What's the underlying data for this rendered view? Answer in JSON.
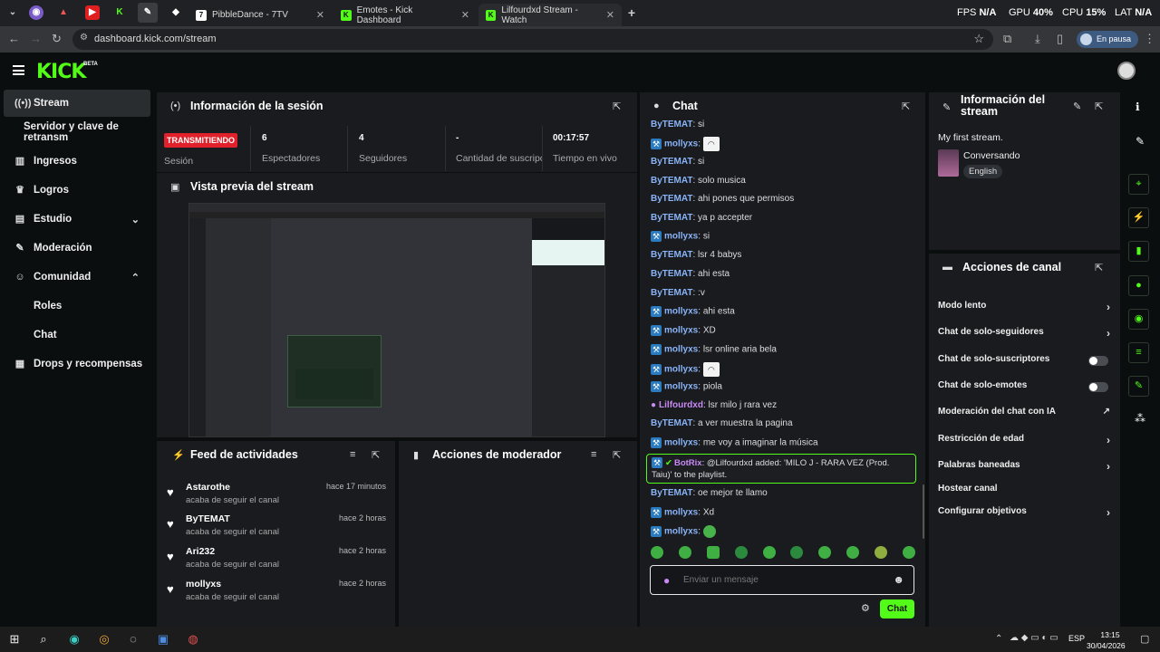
{
  "browser": {
    "tabs": [
      {
        "title": "PibbleDance - 7TV"
      },
      {
        "title": "Emotes - Kick Dashboard"
      },
      {
        "title": "Lilfourdxd Stream - Watch"
      }
    ],
    "stats": {
      "fps_label": "FPS",
      "fps": "N/A",
      "gpu_label": "GPU",
      "gpu": "40%",
      "cpu_label": "CPU",
      "cpu": "15%",
      "lat_label": "LAT",
      "lat": "N/A"
    },
    "url": "dashboard.kick.com/stream",
    "paused_label": "En pausa"
  },
  "kick": {
    "logo": "KICK",
    "beta": "BETA"
  },
  "sidebar": {
    "items": [
      {
        "label": "Stream",
        "icon": "broadcast-icon"
      },
      {
        "label": "Servidor y clave de retransm"
      },
      {
        "label": "Ingresos",
        "icon": "chart-icon"
      },
      {
        "label": "Logros",
        "icon": "trophy-icon"
      },
      {
        "label": "Estudio",
        "icon": "studio-icon"
      },
      {
        "label": "Moderación",
        "icon": "wrench-icon"
      },
      {
        "label": "Comunidad",
        "icon": "people-icon"
      },
      {
        "label": "Roles"
      },
      {
        "label": "Chat"
      },
      {
        "label": "Drops y recompensas",
        "icon": "gift-icon"
      }
    ]
  },
  "session": {
    "title": "Información de la sesión",
    "live_badge": "TRANSMITIENDO",
    "session_label": "Sesión",
    "stats": [
      {
        "value": "6",
        "label": "Espectadores"
      },
      {
        "value": "4",
        "label": "Seguidores"
      },
      {
        "value": "-",
        "label": "Cantidad de suscripciones"
      },
      {
        "value": "00:17:57",
        "label": "Tiempo en vivo"
      }
    ]
  },
  "preview": {
    "title": "Vista previa del stream"
  },
  "feed": {
    "title": "Feed de actividades",
    "items": [
      {
        "name": "Astarothe",
        "sub": "acaba de seguir el canal",
        "time": "hace 17 minutos"
      },
      {
        "name": "ByTEMAT",
        "sub": "acaba de seguir el canal",
        "time": "hace 2 horas"
      },
      {
        "name": "Ari232",
        "sub": "acaba de seguir el canal",
        "time": "hace 2 horas"
      },
      {
        "name": "mollyxs",
        "sub": "acaba de seguir el canal",
        "time": "hace 2 horas"
      }
    ]
  },
  "mod_actions": {
    "title": "Acciones de moderador"
  },
  "chat": {
    "title": "Chat",
    "messages": [
      {
        "user": "ByTEMAT",
        "text": "si",
        "color": "#8ab4f8"
      },
      {
        "user": "mollyxs",
        "text": "",
        "emote": "ghost",
        "color": "#8ab4f8",
        "badge": true
      },
      {
        "user": "ByTEMAT",
        "text": "si",
        "color": "#8ab4f8"
      },
      {
        "user": "ByTEMAT",
        "text": "solo musica",
        "color": "#8ab4f8"
      },
      {
        "user": "ByTEMAT",
        "text": "ahi pones que permisos",
        "color": "#8ab4f8"
      },
      {
        "user": "ByTEMAT",
        "text": "ya p accepter",
        "color": "#8ab4f8"
      },
      {
        "user": "mollyxs",
        "text": "si",
        "color": "#8ab4f8",
        "badge": true
      },
      {
        "user": "ByTEMAT",
        "text": "lsr 4 babys",
        "color": "#8ab4f8"
      },
      {
        "user": "ByTEMAT",
        "text": "ahi esta",
        "color": "#8ab4f8"
      },
      {
        "user": "ByTEMAT",
        "text": ":v",
        "color": "#8ab4f8"
      },
      {
        "user": "mollyxs",
        "text": "ahi esta",
        "color": "#8ab4f8",
        "badge": true
      },
      {
        "user": "mollyxs",
        "text": "XD",
        "color": "#8ab4f8",
        "badge": true
      },
      {
        "user": "mollyxs",
        "text": "lsr online aria bela",
        "color": "#8ab4f8",
        "badge": true
      },
      {
        "user": "mollyxs",
        "text": "",
        "emote": "ghost",
        "color": "#8ab4f8",
        "badge": true
      },
      {
        "user": "mollyxs",
        "text": "piola",
        "color": "#8ab4f8",
        "badge": true
      },
      {
        "user": "Lilfourdxd",
        "text": "lsr milo j rara vez",
        "color": "#c98af5",
        "mic": true
      },
      {
        "user": "ByTEMAT",
        "text": "a ver muestra la pagina",
        "color": "#8ab4f8"
      },
      {
        "user": "mollyxs",
        "text": "me voy a imaginar la música",
        "color": "#8ab4f8",
        "badge": true
      }
    ],
    "botrix": {
      "user": "BotRix",
      "text": "@Lilfourdxd added: 'MILO J - RARA VEZ (Prod. Taiu)' to the playlist."
    },
    "after": [
      {
        "user": "ByTEMAT",
        "text": "oe mejor te llamo",
        "color": "#8ab4f8"
      },
      {
        "user": "mollyxs",
        "text": "Xd",
        "color": "#8ab4f8",
        "badge": true
      },
      {
        "user": "mollyxs",
        "text": "",
        "emote": "frog",
        "color": "#8ab4f8",
        "badge": true
      }
    ],
    "input_placeholder": "Enviar un mensaje",
    "send_label": "Chat"
  },
  "stream_info": {
    "title": "Información del stream",
    "stream_title": "My first stream.",
    "category": "Conversando",
    "language": "English"
  },
  "channel_actions": {
    "title": "Acciones de canal",
    "items": [
      {
        "label": "Modo lento",
        "control": "chevron"
      },
      {
        "label": "Chat de solo-seguidores",
        "control": "chevron"
      },
      {
        "label": "Chat de solo-suscriptores",
        "control": "toggle"
      },
      {
        "label": "Chat de solo-emotes",
        "control": "toggle"
      },
      {
        "label": "Moderación del chat con IA",
        "control": "external"
      },
      {
        "label": "Restricción de edad",
        "control": "chevron"
      },
      {
        "label": "Palabras baneadas",
        "control": "chevron"
      },
      {
        "label": "Hostear canal",
        "control": "none"
      },
      {
        "label": "Configurar objetivos",
        "control": "chevron"
      }
    ]
  },
  "taskbar": {
    "lang": "ESP",
    "time": "13:15",
    "date": "30/04/2026"
  }
}
